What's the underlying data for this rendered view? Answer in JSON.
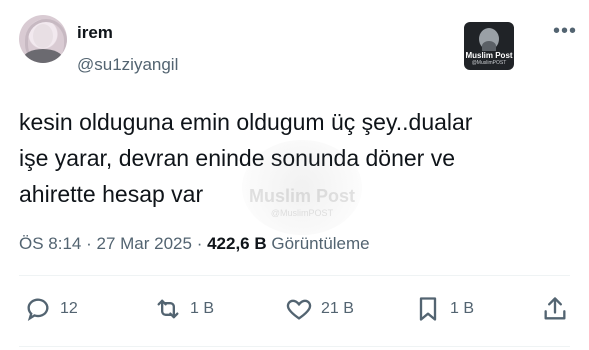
{
  "author": {
    "name": "irem",
    "handle": "@su1ziyangil"
  },
  "badge": {
    "brand": "Muslim Post",
    "sub": "@MuslimPOST"
  },
  "tweet": {
    "text": "kesin olduguna emin oldugum üç şey..dualar\nişe yarar, devran eninde sonunda döner ve\nahirette hesap var"
  },
  "watermark": {
    "brand": "Muslim Post",
    "sub": "@MuslimPOST"
  },
  "meta": {
    "time": "ÖS 8:14",
    "date": "27 Mar 2025",
    "views": "422,6 B",
    "views_label": "Görüntüleme"
  },
  "actions": {
    "replies": "12",
    "reposts": "1 B",
    "likes": "21 B",
    "bookmarks": "1 B"
  },
  "icons": {
    "more": "more-horizontal-icon",
    "reply": "reply-icon",
    "repost": "repost-icon",
    "like": "heart-icon",
    "bookmark": "bookmark-icon",
    "share": "share-icon"
  }
}
